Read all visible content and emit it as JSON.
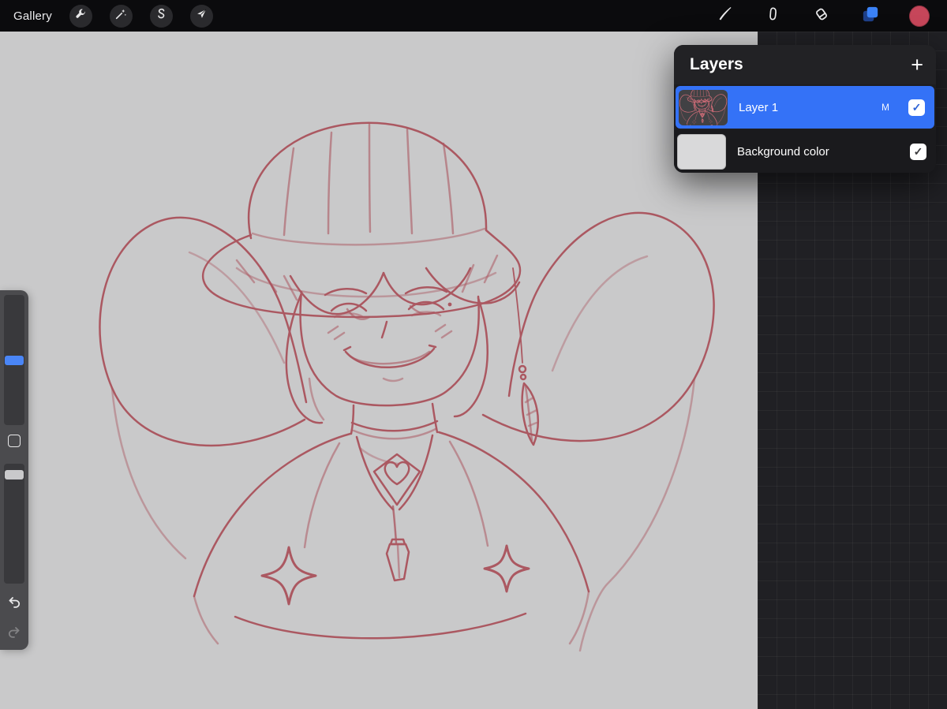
{
  "topbar": {
    "gallery_label": "Gallery",
    "left_tools": [
      {
        "name": "actions",
        "icon": "wrench-icon"
      },
      {
        "name": "adjustments",
        "icon": "magic-wand-icon"
      },
      {
        "name": "selection",
        "icon": "selection-s-icon"
      },
      {
        "name": "transform",
        "icon": "transform-arrow-icon"
      }
    ],
    "right_tools": [
      {
        "name": "paint",
        "icon": "brush-icon"
      },
      {
        "name": "smudge",
        "icon": "smudge-finger-icon"
      },
      {
        "name": "erase",
        "icon": "eraser-icon"
      },
      {
        "name": "layers",
        "icon": "layers-icon",
        "active": true
      },
      {
        "name": "color",
        "icon": "color-swatch-icon",
        "color": "#c6465a"
      }
    ]
  },
  "layers_panel": {
    "title": "Layers",
    "add_button_label": "+",
    "check_glyph": "✓",
    "selected_color": "#3472f7",
    "rows": [
      {
        "name": "Layer 1",
        "blend_badge": "M",
        "visible": true,
        "selected": true
      },
      {
        "name": "Background color",
        "blend_badge": "",
        "visible": true,
        "selected": false
      }
    ]
  },
  "left_toolbar": {
    "items": [
      "brush-size-slider",
      "modify-button",
      "opacity-slider",
      "undo-button",
      "redo-button"
    ]
  },
  "canvas": {
    "background_color": "#c9c9ca",
    "sketch_color": "#a94f59",
    "description": "Red sketch of a smiling character in a bucket hat with fairy wings, feather charm, heart pendant necklace and sparkles"
  }
}
